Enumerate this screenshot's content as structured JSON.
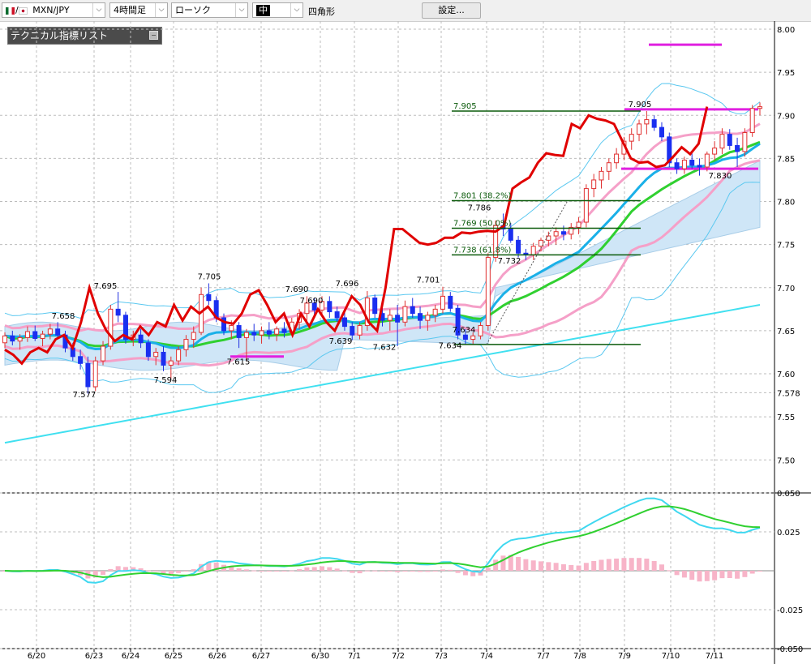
{
  "toolbar": {
    "symbol": "MXN/JPY",
    "timeframe": "4時間足",
    "chart_style": "ローソク",
    "line_width_label": "中",
    "drawing_tool": "四角形",
    "settings_button": "設定..."
  },
  "indicator_panel": {
    "title": "テクニカル指標リスト"
  },
  "chart_data": [
    {
      "type": "candlestick",
      "y_ticks": [
        "8.00",
        "7.95",
        "7.90",
        "7.85",
        "7.80",
        "7.75",
        "7.70",
        "7.65",
        "7.60",
        "7.578",
        "7.55",
        "7.50"
      ],
      "ylim": [
        7.473,
        8.0
      ],
      "x_tick_labels": [
        "6/20",
        "6/23",
        "6/24",
        "6/25",
        "6/26",
        "6/27",
        "6/30",
        "7/1",
        "7/2",
        "7/3",
        "7/4",
        "7/7",
        "7/8",
        "7/9",
        "7/10",
        "7/11"
      ],
      "price_labels": [
        "7.658",
        "7.695",
        "7.577",
        "7.594",
        "7.705",
        "7.615",
        "7.690",
        "7.690",
        "7.696",
        "7.639",
        "7.632",
        "7.701",
        "7.634",
        "7.634",
        "7.786",
        "7.732",
        "7.905",
        "7.830"
      ],
      "fib_levels": [
        {
          "label": "7.905",
          "value": 7.905
        },
        {
          "label": "7.801 (38.2%)",
          "value": 7.801
        },
        {
          "label": "7.769 (50.0%)",
          "value": 7.769
        },
        {
          "label": "7.738 (61.8%)",
          "value": 7.738
        },
        {
          "label": "",
          "value": 7.634
        }
      ],
      "grid": true,
      "candles": [
        [
          7.636,
          7.648,
          7.63,
          7.644
        ],
        [
          7.644,
          7.65,
          7.633,
          7.638
        ],
        [
          7.638,
          7.646,
          7.628,
          7.642
        ],
        [
          7.642,
          7.655,
          7.637,
          7.649
        ],
        [
          7.649,
          7.656,
          7.638,
          7.641
        ],
        [
          7.641,
          7.65,
          7.632,
          7.646
        ],
        [
          7.646,
          7.658,
          7.64,
          7.652
        ],
        [
          7.652,
          7.66,
          7.641,
          7.645
        ],
        [
          7.645,
          7.65,
          7.625,
          7.63
        ],
        [
          7.63,
          7.636,
          7.615,
          7.62
        ],
        [
          7.62,
          7.628,
          7.605,
          7.612
        ],
        [
          7.612,
          7.62,
          7.577,
          7.585
        ],
        [
          7.585,
          7.62,
          7.58,
          7.615
        ],
        [
          7.615,
          7.638,
          7.61,
          7.632
        ],
        [
          7.632,
          7.68,
          7.628,
          7.675
        ],
        [
          7.675,
          7.695,
          7.66,
          7.668
        ],
        [
          7.668,
          7.672,
          7.635,
          7.64
        ],
        [
          7.64,
          7.65,
          7.632,
          7.645
        ],
        [
          7.645,
          7.652,
          7.63,
          7.636
        ],
        [
          7.636,
          7.64,
          7.615,
          7.62
        ],
        [
          7.62,
          7.63,
          7.61,
          7.625
        ],
        [
          7.625,
          7.632,
          7.603,
          7.61
        ],
        [
          7.61,
          7.62,
          7.594,
          7.615
        ],
        [
          7.615,
          7.632,
          7.61,
          7.628
        ],
        [
          7.628,
          7.645,
          7.62,
          7.64
        ],
        [
          7.64,
          7.655,
          7.63,
          7.648
        ],
        [
          7.648,
          7.7,
          7.645,
          7.692
        ],
        [
          7.692,
          7.705,
          7.68,
          7.685
        ],
        [
          7.685,
          7.69,
          7.66,
          7.665
        ],
        [
          7.665,
          7.67,
          7.645,
          7.65
        ],
        [
          7.65,
          7.662,
          7.64,
          7.656
        ],
        [
          7.656,
          7.66,
          7.63,
          7.642
        ],
        [
          7.642,
          7.652,
          7.615,
          7.648
        ],
        [
          7.648,
          7.658,
          7.638,
          7.645
        ],
        [
          7.645,
          7.655,
          7.635,
          7.65
        ],
        [
          7.65,
          7.66,
          7.64,
          7.646
        ],
        [
          7.646,
          7.655,
          7.638,
          7.652
        ],
        [
          7.652,
          7.66,
          7.642,
          7.648
        ],
        [
          7.648,
          7.665,
          7.645,
          7.66
        ],
        [
          7.66,
          7.675,
          7.652,
          7.67
        ],
        [
          7.67,
          7.69,
          7.66,
          7.682
        ],
        [
          7.682,
          7.688,
          7.668,
          7.674
        ],
        [
          7.674,
          7.69,
          7.667,
          7.684
        ],
        [
          7.684,
          7.69,
          7.665,
          7.672
        ],
        [
          7.672,
          7.678,
          7.66,
          7.665
        ],
        [
          7.665,
          7.672,
          7.65,
          7.655
        ],
        [
          7.655,
          7.66,
          7.639,
          7.645
        ],
        [
          7.645,
          7.66,
          7.64,
          7.656
        ],
        [
          7.656,
          7.696,
          7.65,
          7.688
        ],
        [
          7.688,
          7.692,
          7.665,
          7.67
        ],
        [
          7.67,
          7.678,
          7.655,
          7.662
        ],
        [
          7.662,
          7.675,
          7.65,
          7.668
        ],
        [
          7.668,
          7.68,
          7.632,
          7.66
        ],
        [
          7.66,
          7.685,
          7.655,
          7.678
        ],
        [
          7.678,
          7.688,
          7.665,
          7.67
        ],
        [
          7.67,
          7.678,
          7.652,
          7.662
        ],
        [
          7.662,
          7.672,
          7.65,
          7.668
        ],
        [
          7.668,
          7.68,
          7.66,
          7.675
        ],
        [
          7.675,
          7.701,
          7.67,
          7.69
        ],
        [
          7.69,
          7.695,
          7.672,
          7.676
        ],
        [
          7.676,
          7.68,
          7.64,
          7.645
        ],
        [
          7.645,
          7.652,
          7.634,
          7.64
        ],
        [
          7.64,
          7.648,
          7.634,
          7.644
        ],
        [
          7.644,
          7.66,
          7.64,
          7.656
        ],
        [
          7.656,
          7.74,
          7.65,
          7.735
        ],
        [
          7.735,
          7.778,
          7.73,
          7.772
        ],
        [
          7.772,
          7.786,
          7.76,
          7.768
        ],
        [
          7.768,
          7.775,
          7.752,
          7.755
        ],
        [
          7.755,
          7.76,
          7.735,
          7.74
        ],
        [
          7.74,
          7.745,
          7.732,
          7.738
        ],
        [
          7.738,
          7.752,
          7.732,
          7.748
        ],
        [
          7.748,
          7.758,
          7.742,
          7.755
        ],
        [
          7.755,
          7.765,
          7.748,
          7.76
        ],
        [
          7.76,
          7.77,
          7.75,
          7.765
        ],
        [
          7.765,
          7.772,
          7.755,
          7.762
        ],
        [
          7.762,
          7.775,
          7.756,
          7.77
        ],
        [
          7.77,
          7.782,
          7.762,
          7.776
        ],
        [
          7.776,
          7.82,
          7.77,
          7.815
        ],
        [
          7.815,
          7.832,
          7.805,
          7.825
        ],
        [
          7.825,
          7.84,
          7.815,
          7.835
        ],
        [
          7.835,
          7.85,
          7.825,
          7.845
        ],
        [
          7.845,
          7.862,
          7.838,
          7.855
        ],
        [
          7.855,
          7.875,
          7.848,
          7.87
        ],
        [
          7.87,
          7.885,
          7.86,
          7.878
        ],
        [
          7.878,
          7.895,
          7.87,
          7.89
        ],
        [
          7.89,
          7.905,
          7.878,
          7.895
        ],
        [
          7.895,
          7.9,
          7.882,
          7.886
        ],
        [
          7.886,
          7.892,
          7.87,
          7.875
        ],
        [
          7.875,
          7.88,
          7.84,
          7.845
        ],
        [
          7.845,
          7.85,
          7.832,
          7.838
        ],
        [
          7.838,
          7.852,
          7.832,
          7.848
        ],
        [
          7.848,
          7.856,
          7.838,
          7.842
        ],
        [
          7.842,
          7.85,
          7.83,
          7.84
        ],
        [
          7.84,
          7.858,
          7.835,
          7.855
        ],
        [
          7.855,
          7.87,
          7.848,
          7.862
        ],
        [
          7.862,
          7.885,
          7.855,
          7.878
        ],
        [
          7.878,
          7.884,
          7.86,
          7.865
        ],
        [
          7.865,
          7.874,
          7.84,
          7.858
        ],
        [
          7.858,
          7.885,
          7.852,
          7.88
        ],
        [
          7.88,
          7.912,
          7.875,
          7.908
        ],
        [
          7.908,
          7.915,
          7.9,
          7.91
        ]
      ],
      "overlays": [
        {
          "name": "",
          "color": "#e00000",
          "values": [
            [
              0,
              7.628
            ],
            [
              1,
              7.622
            ],
            [
              2,
              7.612
            ],
            [
              3,
              7.625
            ],
            [
              4,
              7.63
            ],
            [
              5,
              7.625
            ],
            [
              6,
              7.64
            ],
            [
              7,
              7.645
            ],
            [
              8,
              7.63
            ],
            [
              9,
              7.66
            ],
            [
              10,
              7.7
            ],
            [
              11,
              7.67
            ],
            [
              12,
              7.65
            ],
            [
              13,
              7.638
            ],
            [
              14,
              7.645
            ],
            [
              15,
              7.64
            ],
            [
              16,
              7.655
            ],
            [
              17,
              7.645
            ],
            [
              18,
              7.66
            ],
            [
              19,
              7.655
            ],
            [
              20,
              7.68
            ],
            [
              21,
              7.662
            ],
            [
              22,
              7.678
            ],
            [
              23,
              7.67
            ],
            [
              24,
              7.678
            ],
            [
              25,
              7.665
            ],
            [
              26,
              7.66
            ],
            [
              27,
              7.658
            ],
            [
              28,
              7.67
            ],
            [
              29,
              7.692
            ],
            [
              30,
              7.697
            ],
            [
              31,
              7.68
            ],
            [
              32,
              7.66
            ],
            [
              33,
              7.67
            ],
            [
              34,
              7.645
            ],
            [
              35,
              7.67
            ],
            [
              36,
              7.655
            ],
            [
              37,
              7.675
            ],
            [
              38,
              7.66
            ],
            [
              39,
              7.65
            ],
            [
              40,
              7.67
            ],
            [
              41,
              7.69
            ],
            [
              42,
              7.68
            ],
            [
              43,
              7.66
            ],
            [
              44,
              7.65
            ],
            [
              45,
              7.7
            ],
            [
              46,
              7.768
            ],
            [
              47,
              7.768
            ],
            [
              48,
              7.76
            ],
            [
              49,
              7.752
            ],
            [
              50,
              7.75
            ],
            [
              51,
              7.752
            ],
            [
              52,
              7.758
            ],
            [
              53,
              7.758
            ],
            [
              54,
              7.764
            ],
            [
              55,
              7.763
            ],
            [
              56,
              7.765
            ],
            [
              57,
              7.766
            ],
            [
              58,
              7.765
            ],
            [
              59,
              7.772
            ],
            [
              60,
              7.815
            ],
            [
              61,
              7.822
            ],
            [
              62,
              7.828
            ],
            [
              63,
              7.845
            ],
            [
              64,
              7.856
            ],
            [
              65,
              7.854
            ],
            [
              66,
              7.853
            ],
            [
              67,
              7.89
            ],
            [
              68,
              7.885
            ],
            [
              69,
              7.9
            ],
            [
              70,
              7.896
            ],
            [
              71,
              7.894
            ],
            [
              72,
              7.89
            ],
            [
              73,
              7.87
            ],
            [
              74,
              7.85
            ],
            [
              75,
              7.845
            ],
            [
              76,
              7.846
            ],
            [
              77,
              7.84
            ],
            [
              78,
              7.842
            ],
            [
              79,
              7.852
            ],
            [
              80,
              7.863
            ],
            [
              81,
              7.855
            ],
            [
              82,
              7.867
            ],
            [
              83,
              7.91
            ]
          ]
        }
      ]
    },
    {
      "type": "line",
      "y_ticks": [
        "0.050",
        "0.025",
        "-0.025",
        "-0.050"
      ],
      "ylim": [
        -0.05,
        0.05
      ]
    }
  ]
}
